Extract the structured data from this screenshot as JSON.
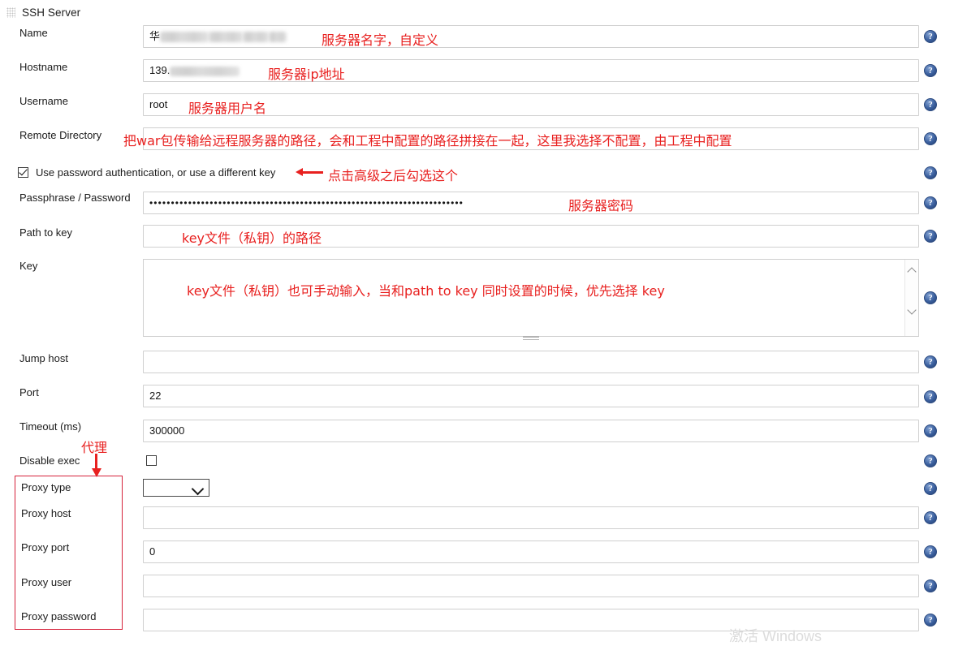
{
  "section": {
    "title": "SSH Server",
    "drag_handle_icon": "drag-grip-icon"
  },
  "help_icon_glyph": "?",
  "fields": [
    {
      "label": "Name",
      "value_prefix": "华",
      "value_redacted": true,
      "annotation": "服务器名字，自定义"
    },
    {
      "label": "Hostname",
      "value_prefix": "139.",
      "value_redacted": true,
      "annotation": "服务器ip地址"
    },
    {
      "label": "Username",
      "value_prefix": "root",
      "value_redacted": false,
      "annotation": "服务器用户名"
    },
    {
      "label": "Remote Directory",
      "value_prefix": "",
      "value_redacted": false,
      "annotation": "把war包传输给远程服务器的路径，会和工程中配置的路径拼接在一起，这里我选择不配置，由工程中配置"
    }
  ],
  "checkbox": {
    "label": "Use password authentication, or use a different key",
    "checked": true,
    "annotation": "点击高级之后勾选这个"
  },
  "password_field": {
    "label": "Passphrase / Password",
    "value": "•••••••••••••••••••••••••••••••••••••••••••••••••••••••••••••••••••••••••",
    "annotation": "服务器密码"
  },
  "path_to_key": {
    "label": "Path to key",
    "value": "",
    "annotation": "key文件（私钥）的路径"
  },
  "key_area": {
    "label": "Key",
    "value": "",
    "annotation": "key文件（私钥）也可手动输入，当和path to key 同时设置的时候，优先选择 key",
    "scroll_up_icon": "chevron-up-icon",
    "scroll_down_icon": "chevron-down-icon",
    "resize_icon": "resize-grip-icon"
  },
  "lower_fields": [
    {
      "label": "Jump host",
      "value": ""
    },
    {
      "label": "Port",
      "value": "22"
    },
    {
      "label": "Timeout (ms)",
      "value": "300000"
    }
  ],
  "disable_exec": {
    "label": "Disable exec",
    "checked": false
  },
  "proxy_annotation": "代理",
  "proxy": {
    "type": {
      "label": "Proxy type",
      "value": "",
      "options": [
        ""
      ]
    },
    "host": {
      "label": "Proxy host",
      "value": ""
    },
    "port": {
      "label": "Proxy port",
      "value": "0"
    },
    "user": {
      "label": "Proxy user",
      "value": ""
    },
    "password": {
      "label": "Proxy password",
      "value": ""
    }
  },
  "watermark": "激活 Windows",
  "colors": {
    "annotation_red": "#e8201f",
    "box_red": "#d6213a",
    "help_blue": "#3a5f9e",
    "field_border": "#cfcfcf"
  }
}
